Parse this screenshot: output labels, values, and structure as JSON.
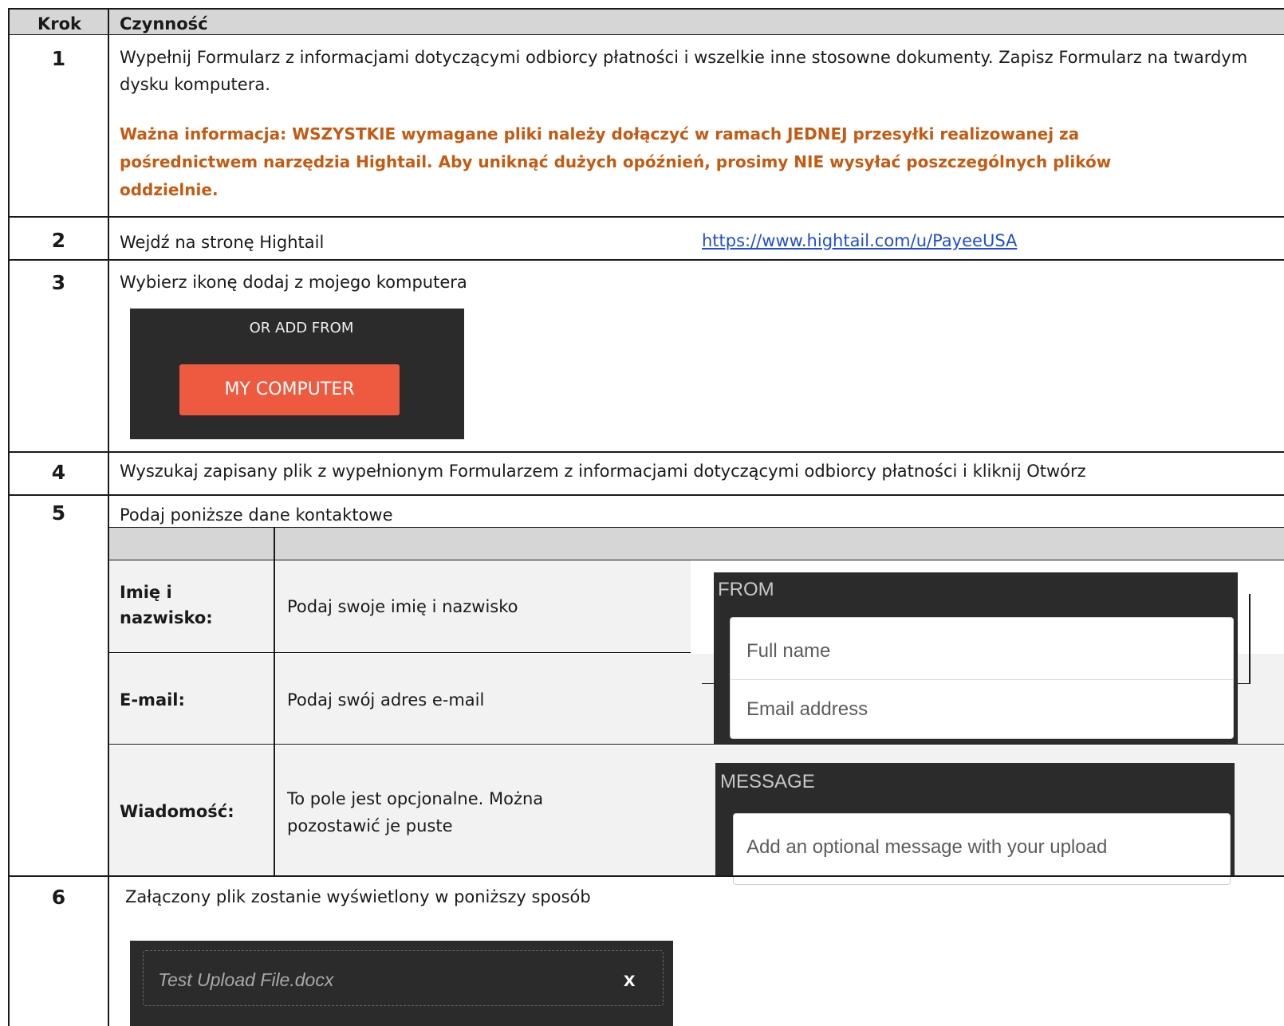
{
  "header": {
    "step_col": "Krok",
    "action_col": "Czynność"
  },
  "steps": [
    {
      "num": "1",
      "text": "Wypełnij Formularz z informacjami dotyczącymi odbiorcy płatności i wszelkie inne stosowne dokumenty. Zapisz Formularz na twardym dysku komputera.",
      "note": "Ważna informacja: WSZYSTKIE wymagane pliki należy dołączyć w ramach JEDNEJ przesyłki realizowanej za pośrednictwem narzędzia Hightail. Aby uniknąć dużych opóźnień, prosimy NIE wysyłać poszczególnych plików oddzielnie."
    },
    {
      "num": "2",
      "text": "Wejdź na stronę Hightail",
      "link": "https://www.hightail.com/u/PayeeUSA"
    },
    {
      "num": "3",
      "text": "Wybierz ikonę  dodaj z mojego komputera",
      "panel_label": "OR ADD FROM",
      "panel_button": "MY COMPUTER"
    },
    {
      "num": "4",
      "text": "Wyszukaj zapisany plik z wypełnionym Formularzem z informacjami dotyczącymi odbiorcy płatności i kliknij Otwórz"
    },
    {
      "num": "5",
      "text": "Podaj poniższe dane kontaktowe",
      "rows": [
        {
          "label": "Imię i nazwisko:",
          "desc": "Podaj swoje imię i nazwisko"
        },
        {
          "label": "E-mail:",
          "desc": "Podaj swój adres e-mail"
        },
        {
          "label": "Wiadomość:",
          "desc": "To pole jest opcjonalne. Można pozostawić je puste"
        }
      ],
      "from_label": "FROM",
      "fullname_placeholder": "Full name",
      "email_placeholder": "Email address",
      "message_label": "MESSAGE",
      "message_placeholder": "Add an optional message with your upload"
    },
    {
      "num": "6",
      "text": "Załączony plik zostanie wyświetlony w poniższy sposób",
      "file_name": "Test Upload File.docx",
      "remove_glyph": "x"
    }
  ],
  "colors": {
    "accent": "#ee5a40",
    "warning": "#c55a11",
    "link": "#1f4dd6",
    "dark_panel": "#2b2b2b"
  }
}
